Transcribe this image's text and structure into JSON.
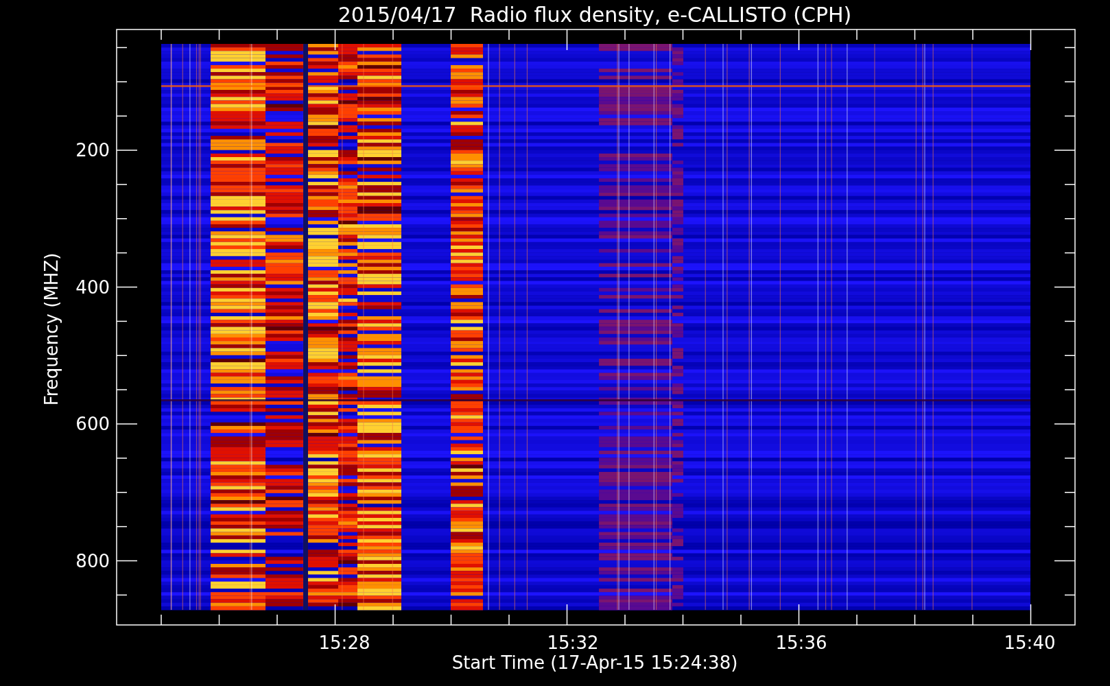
{
  "title": "2015/04/17  Radio flux density, e-CALLISTO (CPH)",
  "y_axis": {
    "label": "Frequency (MHZ)",
    "ticks": [
      "200",
      "400",
      "600",
      "800"
    ]
  },
  "x_axis": {
    "label": "Start Time (17-Apr-15 15:24:38)",
    "ticks": [
      "15:28",
      "15:32",
      "15:36",
      "15:40"
    ]
  }
}
